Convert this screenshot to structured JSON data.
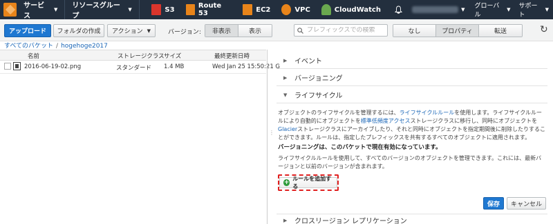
{
  "topnav": {
    "services": "サービス",
    "resource_groups": "リソースグループ",
    "shortcuts": [
      {
        "label": "S3",
        "color": "#d9352c"
      },
      {
        "label": "Route 53",
        "color": "#e8841a"
      },
      {
        "label": "EC2",
        "color": "#e8841a"
      },
      {
        "label": "VPC",
        "color": "#e8841a"
      },
      {
        "label": "CloudWatch",
        "color": "#6aa84f"
      }
    ],
    "region": "グローバル",
    "support": "サポート"
  },
  "toolbar": {
    "upload": "アップロード",
    "create_folder": "フォルダの作成",
    "actions": "アクション",
    "versions_label": "バージョン:",
    "hide": "非表示",
    "show": "表示",
    "search_placeholder": "プレフィックスでの検索",
    "view_none": "なし",
    "view_properties": "プロパティ",
    "view_transfers": "転送"
  },
  "breadcrumb": {
    "root": "すべてのバケット",
    "bucket": "hogehoge2017"
  },
  "table": {
    "headers": [
      "名前",
      "ストレージクラス",
      "サイズ",
      "最終更新日時"
    ],
    "rows": [
      {
        "name": "2016-06-19-02.png",
        "storage": "スタンダード",
        "size": "1.4 MB",
        "modified": "Wed Jan 25 15:50:21 G"
      }
    ]
  },
  "panel": {
    "sections": [
      "イベント",
      "バージョニング",
      "ライフサイクル",
      "クロスリージョン レプリケーション"
    ],
    "desc_1": "オブジェクトのライフサイクルを管理するには、",
    "desc_link1": "ライフサイクルルール",
    "desc_2": "を使用します。ライフサイクルルールにより自動的にオブジェクトを",
    "desc_link2": "標準低頻度アクセス",
    "desc_3": "ストレージクラスに移行し、同時にオブジェクトを",
    "desc_link3": "Glacier",
    "desc_4": "ストレージクラスにアーカイブしたり、それと同時にオブジェクトを指定期間後に削除したりすることができます。ルールは、指定したプレフィックスを共有するすべてのオブジェクトに適用されます。",
    "versioning_note": "バージョニングは、このバケットで現在有効になっています。",
    "versioning_desc": "ライフサイクルルールを使用して、すべてのバージョンのオブジェクトを管理できます。これには、最新バージョンと以前のバージョンが含まれます。",
    "add_rule": "ルールを追加する",
    "save": "保存",
    "cancel": "キャンセル"
  }
}
